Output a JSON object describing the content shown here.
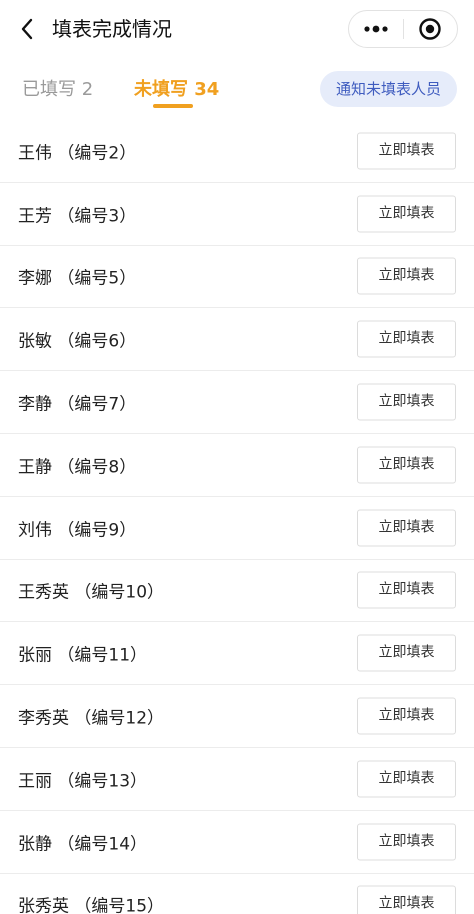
{
  "header": {
    "title": "填表完成情况"
  },
  "tabs": {
    "filled_label": "已填写 2",
    "unfilled_label": "未填写 34"
  },
  "notify_button": "通知未填表人员",
  "rows": [
    {
      "name": "王伟 （编号2）",
      "action": "立即填表"
    },
    {
      "name": "王芳 （编号3）",
      "action": "立即填表"
    },
    {
      "name": "李娜 （编号5）",
      "action": "立即填表"
    },
    {
      "name": "张敏 （编号6）",
      "action": "立即填表"
    },
    {
      "name": "李静 （编号7）",
      "action": "立即填表"
    },
    {
      "name": "王静 （编号8）",
      "action": "立即填表"
    },
    {
      "name": "刘伟 （编号9）",
      "action": "立即填表"
    },
    {
      "name": "王秀英 （编号10）",
      "action": "立即填表"
    },
    {
      "name": "张丽 （编号11）",
      "action": "立即填表"
    },
    {
      "name": "李秀英 （编号12）",
      "action": "立即填表"
    },
    {
      "name": "王丽 （编号13）",
      "action": "立即填表"
    },
    {
      "name": "张静 （编号14）",
      "action": "立即填表"
    },
    {
      "name": "张秀英 （编号15）",
      "action": "立即填表"
    }
  ],
  "icons": {
    "back": "back-chevron-icon",
    "more": "more-dots-icon",
    "close": "miniprogram-close-icon"
  }
}
